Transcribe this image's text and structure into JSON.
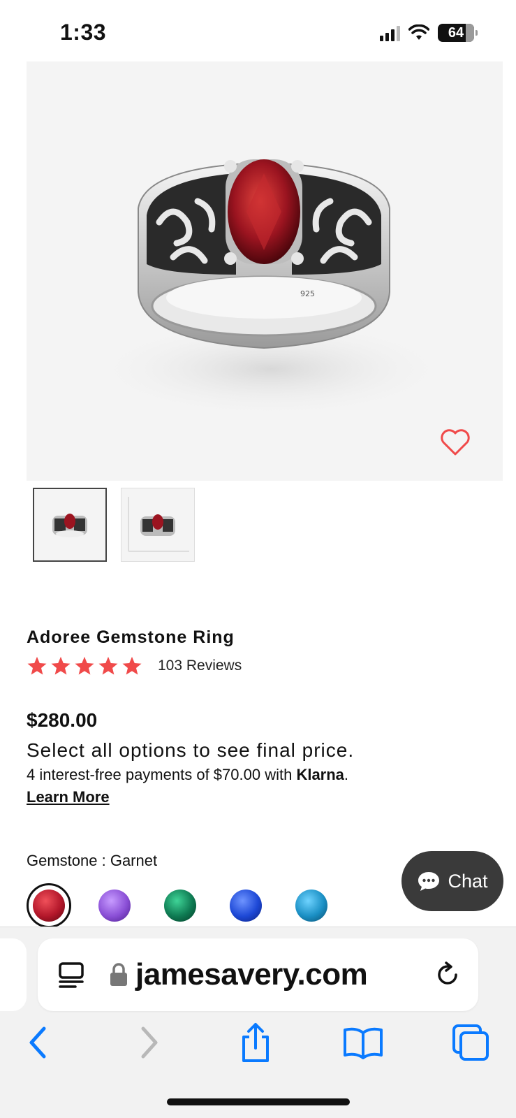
{
  "status_bar": {
    "time": "1:33",
    "battery": "64"
  },
  "product": {
    "title": "Adoree Gemstone Ring",
    "rating_stars": 5,
    "reviews": "103 Reviews",
    "price": "$280.00",
    "select_message": "Select all options to see final price.",
    "klarna_prefix": "4 interest-free payments of $70.00 with ",
    "klarna_brand": "Klarna",
    "klarna_suffix": ".",
    "learn_more": "Learn More",
    "gemstone_label": "Gemstone : Garnet"
  },
  "gemstones": [
    {
      "name": "garnet",
      "color": "#b3172a",
      "selected": true
    },
    {
      "name": "amethyst",
      "color": "#8a4fd6",
      "selected": false
    },
    {
      "name": "emerald",
      "color": "#0e7a52",
      "selected": false
    },
    {
      "name": "sapphire",
      "color": "#1d48d6",
      "selected": false
    },
    {
      "name": "blue-topaz",
      "color": "#1a8fc4",
      "selected": false
    }
  ],
  "chat": {
    "label": "Chat"
  },
  "browser": {
    "url": "jamesavery.com"
  },
  "colors": {
    "accent_red": "#f04a4a",
    "ios_blue": "#0a7aff",
    "chat_bg": "#3a3a3a"
  },
  "icons": [
    "heart-icon",
    "star-icon",
    "chat-bubble-icon",
    "reader-icon",
    "lock-icon",
    "reload-icon",
    "back-icon",
    "forward-icon",
    "share-icon",
    "bookmarks-icon",
    "tabs-icon"
  ]
}
